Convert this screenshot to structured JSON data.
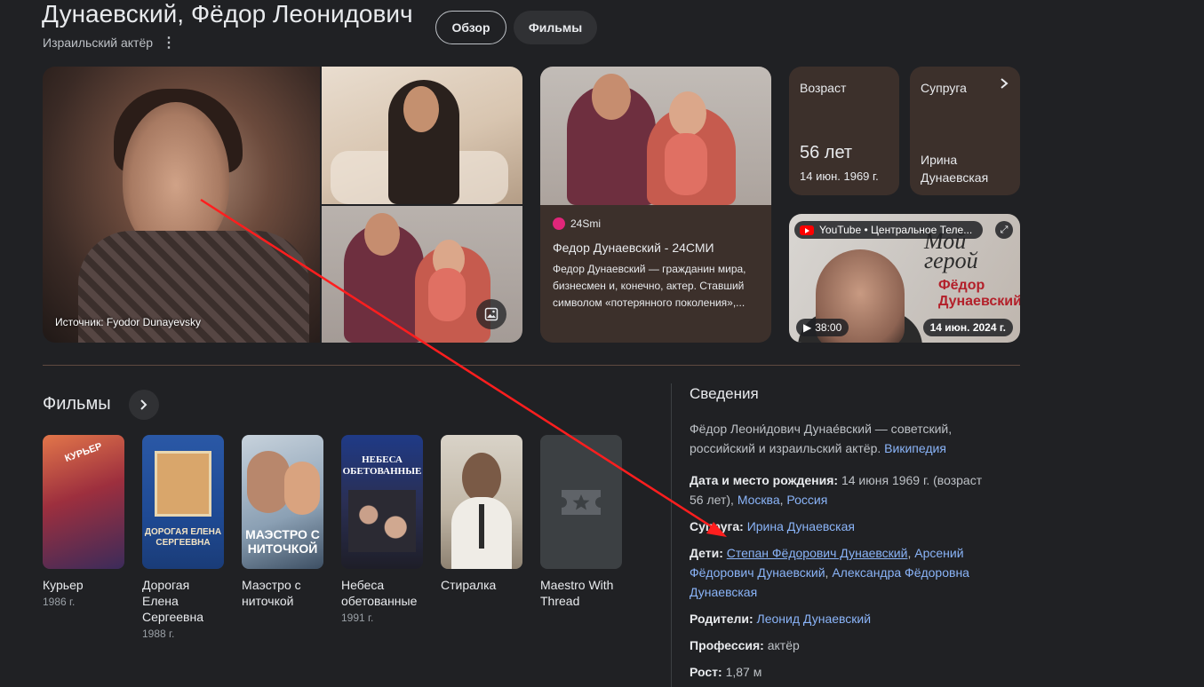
{
  "header": {
    "title": "Дунаевский, Фёдор Леонидович",
    "subtitle": "Израильский актёр",
    "more_icon": "⋮"
  },
  "tabs": [
    {
      "label": "Обзор"
    },
    {
      "label": "Фильмы"
    }
  ],
  "main_image": {
    "caption": "Источник: Fyodor Dunayevsky"
  },
  "article_card": {
    "source": "24Smi",
    "title": "Федор Дунаевский - 24СМИ",
    "snippet": "Федор Дунаевский — гражданин мира, бизнесмен и, конечно, актер. Ставший символом «потерянного поколения»,..."
  },
  "age_tile": {
    "label": "Возраст",
    "value": "56 лет",
    "date": "14 июн. 1969 г."
  },
  "spouse_tile": {
    "label": "Супруга",
    "name": "Ирина Дунаевская"
  },
  "video": {
    "channel": "YouTube • Центральное Теле...",
    "overlay_line1": "Мой герой",
    "overlay_line2": "Фёдор Дунаевский",
    "duration": "38:00",
    "date": "14 июн. 2024 г."
  },
  "films": {
    "heading": "Фильмы",
    "items": [
      {
        "title": "Курьер",
        "year": "1986 г.",
        "poster_text": "КУРЬЕР"
      },
      {
        "title": "Дорогая Елена Сергеевна",
        "year": "1988 г.",
        "poster_text": "ДОРОГАЯ ЕЛЕНА СЕРГЕЕВНА"
      },
      {
        "title": "Маэстро с ниточкой",
        "year": "",
        "poster_text": "МАЭСТРО С НИТОЧКОЙ"
      },
      {
        "title": "Небеса обетованные",
        "year": "1991 г.",
        "poster_text": "НЕБЕСА ОБЕТОВАННЫЕ"
      },
      {
        "title": "Стиралка",
        "year": ""
      },
      {
        "title": "Maestro With Thread",
        "year": ""
      }
    ]
  },
  "info": {
    "heading": "Сведения",
    "description": "Фёдор Леони́дович Дунае́вский — советский, российский и израильский актёр.",
    "wiki_link": "Википедия",
    "birth_label": "Дата и место рождения:",
    "birth_value": "14 июня 1969 г. (возраст 56 лет),",
    "birth_city": "Москва",
    "birth_country": "Россия",
    "spouse_label": "Супруга:",
    "spouse_value": "Ирина Дунаевская",
    "children_label": "Дети:",
    "child1": "Степан Фёдорович Дунаевский",
    "child2": "Арсений Фёдорович Дунаевский",
    "child3": "Александра Фёдоровна Дунаевская",
    "parents_label": "Родители:",
    "parents_value": "Леонид Дунаевский",
    "profession_label": "Профессия:",
    "profession_value": "актёр",
    "height_label": "Рост:",
    "height_value": "1,87 м"
  },
  "colors": {
    "background": "#202124",
    "card": "#3c302b",
    "link": "#8ab4f8",
    "annotation_arrow": "#ff0000"
  }
}
